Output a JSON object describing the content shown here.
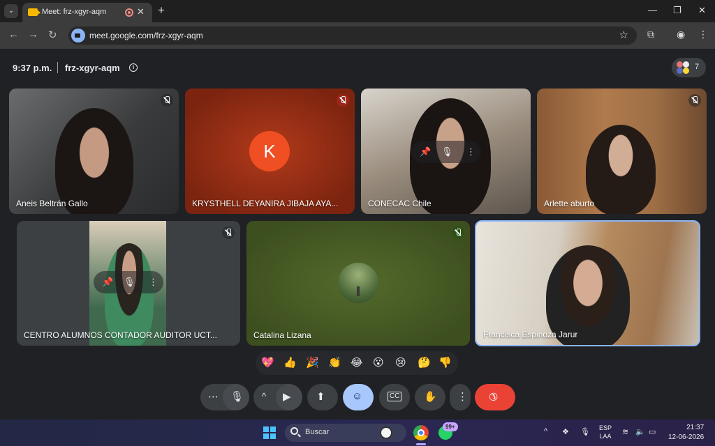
{
  "browser": {
    "tab_title": "Meet: frz-xgyr-aqm",
    "tab_close": "✕",
    "new_tab": "+",
    "url": "meet.google.com/frz-xgyr-aqm"
  },
  "meeting": {
    "time": "9:37 p.m.",
    "code": "frz-xgyr-aqm",
    "participant_count": "7"
  },
  "tiles": [
    {
      "name": "Aneis Beltrán Gallo",
      "muted": true
    },
    {
      "name": "KRYSTHELL DEYANIRA JIBAJA AYA...",
      "avatar_letter": "K",
      "muted": true
    },
    {
      "name": "CONECAC Chile",
      "muted": false
    },
    {
      "name": "Arlette aburto",
      "muted": true
    },
    {
      "name": "CENTRO ALUMNOS CONTADOR AUDITOR UCT...",
      "muted": true
    },
    {
      "name": "Catalina Lizana",
      "muted": true
    },
    {
      "name": "Francisca Espinoza Jarur",
      "muted": false,
      "speaking": true
    }
  ],
  "reactions": [
    "💖",
    "👍",
    "🎉",
    "👏",
    "😂",
    "😮",
    "😢",
    "🤔",
    "👎"
  ],
  "controls": {
    "more_glyph": "⋯",
    "chevron": "^",
    "mic_icon": "microphone-icon",
    "cam_icon": "camera-icon"
  },
  "taskbar": {
    "search_label": "Buscar",
    "whatsapp_badge": "99+",
    "lang_line1": "ESP",
    "lang_line2": "LAA",
    "clock_time": "21:37",
    "clock_date": "12-06-2026"
  },
  "colors": {
    "end_call": "#ea4335",
    "reaction_button": "#a8c7fa",
    "avatar_k": "#f04e23",
    "speaking_border": "#8ab4f8"
  }
}
